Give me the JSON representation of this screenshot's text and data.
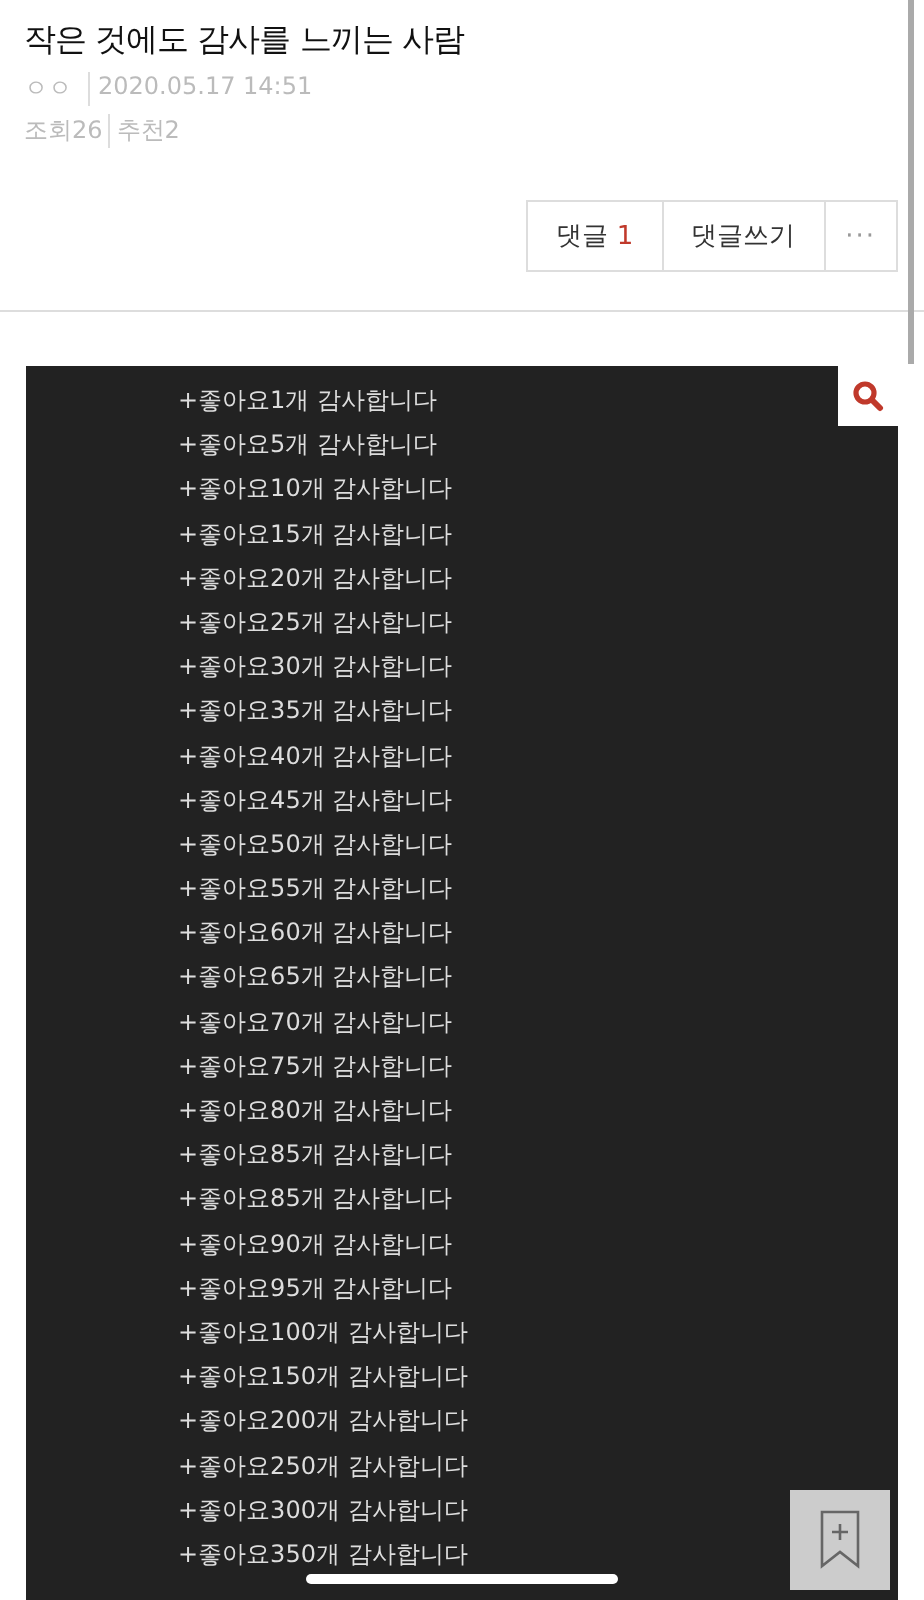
{
  "post": {
    "title": "작은 것에도 감사를 느끼는 사람",
    "author": "ㅇㅇ",
    "date": "2020.05.17 14:51",
    "views_label": "조회",
    "views": "26",
    "likes_label": "추천",
    "likes": "2"
  },
  "actions": {
    "comments_label": "댓글",
    "comments_count": "1",
    "write_comment": "댓글쓰기",
    "more": "···"
  },
  "image_lines": [
    "+좋아요1개 감사합니다",
    "+좋아요5개 감사합니다",
    "+좋아요10개 감사합니다",
    "+좋아요15개 감사합니다",
    "+좋아요20개 감사합니다",
    "+좋아요25개 감사합니다",
    "+좋아요30개 감사합니다",
    "+좋아요35개 감사합니다",
    "+좋아요40개 감사합니다",
    "+좋아요45개 감사합니다",
    "+좋아요50개 감사합니다",
    "+좋아요55개 감사합니다",
    "+좋아요60개 감사합니다",
    "+좋아요65개 감사합니다",
    "+좋아요70개 감사합니다",
    "+좋아요75개 감사합니다",
    "+좋아요80개 감사합니다",
    "+좋아요85개 감사합니다",
    "+좋아요85개 감사합니다",
    "+좋아요90개 감사합니다",
    "+좋아요95개 감사합니다",
    "+좋아요100개 감사합니다",
    "+좋아요150개 감사합니다",
    "+좋아요200개 감사합니다",
    "+좋아요250개 감사합니다",
    "+좋아요300개 감사합니다",
    "+좋아요350개 감사합니다"
  ]
}
